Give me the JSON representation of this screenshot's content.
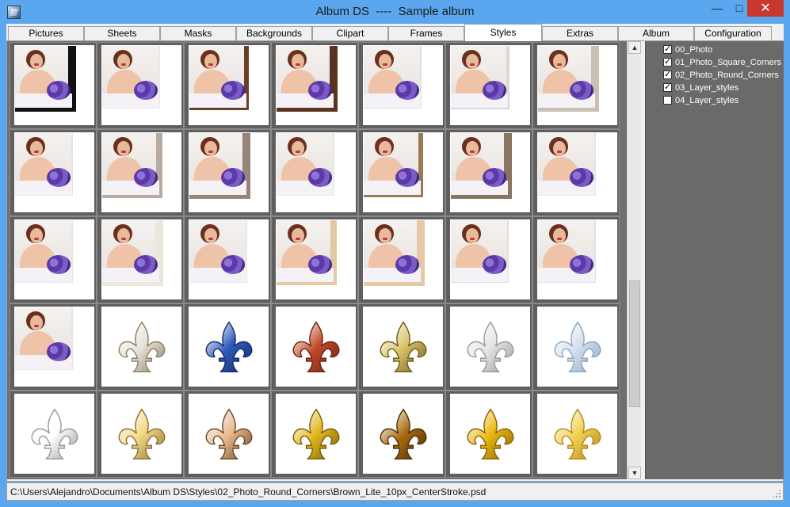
{
  "window": {
    "title": "Album DS  ----  Sample album",
    "min_label": "—",
    "max_label": "□",
    "close_label": "✕"
  },
  "tabs": [
    {
      "label": "Pictures"
    },
    {
      "label": "Sheets"
    },
    {
      "label": "Masks"
    },
    {
      "label": "Backgrounds"
    },
    {
      "label": "Clipart"
    },
    {
      "label": "Frames"
    },
    {
      "label": "Styles",
      "active": true
    },
    {
      "label": "Extras"
    },
    {
      "label": "Album"
    },
    {
      "label": "Configuration"
    }
  ],
  "layers": [
    {
      "label": "00_Photo",
      "checked": true
    },
    {
      "label": "01_Photo_Square_Corners",
      "checked": true
    },
    {
      "label": "02_Photo_Round_Corners",
      "checked": true
    },
    {
      "label": "03_Layer_styles",
      "checked": true
    },
    {
      "label": "04_Layer_styles",
      "checked": false
    }
  ],
  "scrollbar": {
    "up_icon": "▲",
    "down_icon": "▼"
  },
  "status": {
    "path": "C:\\Users\\Alejandro\\Documents\\Album DS\\Styles\\02_Photo_Round_Corners\\Brown_Lite_10px_CenterStroke.psd"
  },
  "colors": {
    "titlebar": "#5aa7ef",
    "grid_bg": "#6f6f6f",
    "layers_bg": "#6a6a6a",
    "close_button": "#c7382e"
  },
  "thumbnails": [
    {
      "kind": "photo",
      "frame": "#111111",
      "frame_w": 5
    },
    {
      "kind": "photo",
      "frame": "#e8e8e8",
      "frame_w": 1
    },
    {
      "kind": "photo",
      "frame": "#6b3e2a",
      "frame_w": 3
    },
    {
      "kind": "photo",
      "frame": "#5a3220",
      "frame_w": 5
    },
    {
      "kind": "photo",
      "frame": "#e0e0e0",
      "frame_w": 1
    },
    {
      "kind": "photo",
      "frame": "#d8d8d8",
      "frame_w": 2
    },
    {
      "kind": "photo",
      "frame": "#c9c0b4",
      "frame_w": 5
    },
    {
      "kind": "photo",
      "frame": "#e4e4e4",
      "frame_w": 1
    },
    {
      "kind": "photo",
      "frame": "#b8aca0",
      "frame_w": 4
    },
    {
      "kind": "photo",
      "frame": "#968478",
      "frame_w": 5
    },
    {
      "kind": "photo",
      "frame": "#e6e6e6",
      "frame_w": 1
    },
    {
      "kind": "photo",
      "frame": "#9a7a55",
      "frame_w": 3
    },
    {
      "kind": "photo",
      "frame": "#8a7560",
      "frame_w": 5
    },
    {
      "kind": "photo",
      "frame": "#e6e6e6",
      "frame_w": 1
    },
    {
      "kind": "photo",
      "frame": "#e8e8e8",
      "frame_w": 1
    },
    {
      "kind": "photo",
      "frame": "#ece6dc",
      "frame_w": 5
    },
    {
      "kind": "photo",
      "frame": "#e8e8e8",
      "frame_w": 1
    },
    {
      "kind": "photo",
      "frame": "#e2c9a4",
      "frame_w": 4
    },
    {
      "kind": "photo",
      "frame": "#e5c8a8",
      "frame_w": 5
    },
    {
      "kind": "photo",
      "frame": "#e0e0e0",
      "frame_w": 1
    },
    {
      "kind": "photo",
      "frame": "#e2e2e2",
      "frame_w": 1
    },
    {
      "kind": "photo",
      "frame": "#e6e6e6",
      "frame_w": 1
    },
    {
      "kind": "fleur",
      "fill": "#e7e2d6",
      "stroke": "#8c7f68"
    },
    {
      "kind": "fleur",
      "fill": "#2f58b8",
      "stroke": "#142e6e"
    },
    {
      "kind": "fleur",
      "fill": "#c24a2a",
      "stroke": "#6c2414"
    },
    {
      "kind": "fleur",
      "fill": "#d8c46a",
      "stroke": "#6e5c1c"
    },
    {
      "kind": "fleur",
      "fill": "#e4e4e4",
      "stroke": "#9a9a9a"
    },
    {
      "kind": "fleur",
      "fill": "#d4e0ee",
      "stroke": "#8fa6c2"
    },
    {
      "kind": "fleur",
      "fill": "#ffffff",
      "stroke": "#9a9a9a"
    },
    {
      "kind": "fleur",
      "fill": "#f2d885",
      "stroke": "#8d7234"
    },
    {
      "kind": "fleur",
      "fill": "#e8b98e",
      "stroke": "#6c4a2a"
    },
    {
      "kind": "fleur",
      "fill": "#e0b81c",
      "stroke": "#7c5e08"
    },
    {
      "kind": "fleur",
      "fill": "#a86a12",
      "stroke": "#4c2e04"
    },
    {
      "kind": "fleur",
      "fill": "#e8b812",
      "stroke": "#8a6404"
    },
    {
      "kind": "fleur",
      "fill": "#f1cf52",
      "stroke": "#b48a18"
    }
  ]
}
